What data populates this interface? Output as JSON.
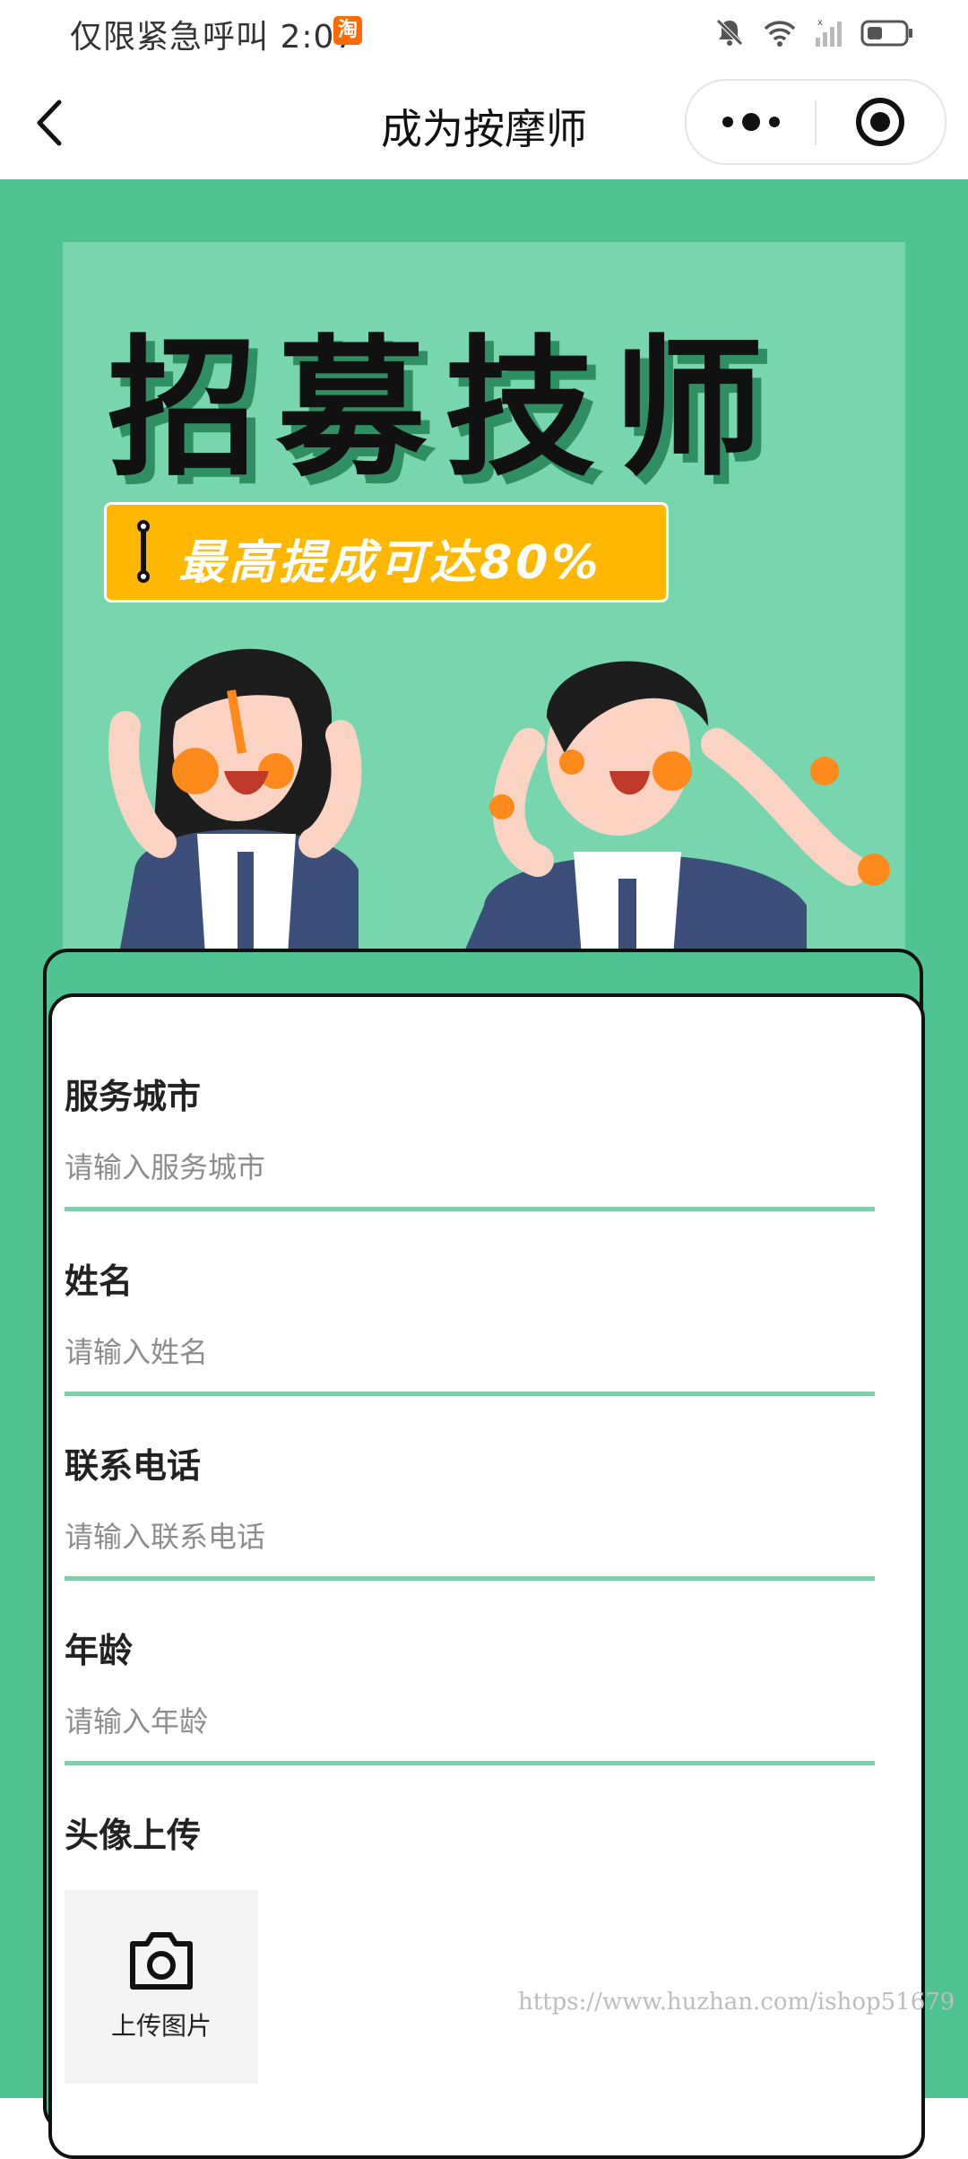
{
  "status_bar": {
    "left_text": "仅限紧急呼叫 2:07",
    "app_badge": "淘"
  },
  "nav": {
    "title": "成为按摩师"
  },
  "banner": {
    "headline": "招募技师",
    "promo": "最高提成可达80%"
  },
  "form": {
    "fields": [
      {
        "label": "服务城市",
        "placeholder": "请输入服务城市",
        "value": ""
      },
      {
        "label": "姓名",
        "placeholder": "请输入姓名",
        "value": ""
      },
      {
        "label": "联系电话",
        "placeholder": "请输入联系电话",
        "value": ""
      },
      {
        "label": "年龄",
        "placeholder": "请输入年龄",
        "value": ""
      }
    ],
    "avatar_upload": {
      "label": "头像上传",
      "button_label": "上传图片"
    }
  },
  "watermark": "https://www.huzhan.com/ishop51679",
  "colors": {
    "primary_green": "#4fc391",
    "banner_green": "#77d6ad",
    "accent_yellow": "#ffb700",
    "underline": "#7fcfac"
  },
  "icons": [
    "back-arrow-icon",
    "more-dots-icon",
    "close-circle-icon",
    "mute-bell-icon",
    "wifi-icon",
    "signal-icon",
    "battery-icon",
    "camera-icon"
  ]
}
